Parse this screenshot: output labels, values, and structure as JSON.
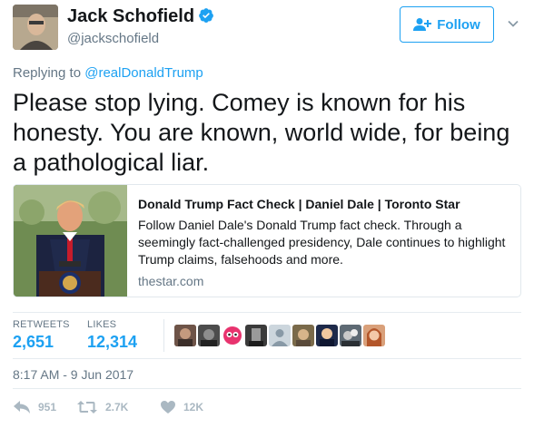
{
  "user": {
    "name": "Jack Schofield",
    "handle": "@jackschofield",
    "follow_label": "Follow"
  },
  "reply": {
    "prefix": "Replying to ",
    "target": "@realDonaldTrump"
  },
  "tweet": {
    "text": "Please stop lying. Comey is known for his honesty. You are known, world wide, for being a pathological liar."
  },
  "card": {
    "title": "Donald Trump Fact Check | Daniel Dale | Toronto Star",
    "description": "Follow Daniel Dale's Donald Trump fact check. Through a seemingly fact-challenged presidency, Dale continues to highlight Trump claims, falsehoods and more.",
    "domain": "thestar.com"
  },
  "stats": {
    "retweets_label": "RETWEETS",
    "retweets_value": "2,651",
    "likes_label": "LIKES",
    "likes_value": "12,314"
  },
  "timestamp": "8:17 AM - 9 Jun 2017",
  "actions": {
    "reply_count": "951",
    "retweet_count": "2.7K",
    "like_count": "12K"
  },
  "colors": {
    "accent": "#1da1f2",
    "muted": "#657786",
    "icon_gray": "#aab8c2"
  }
}
